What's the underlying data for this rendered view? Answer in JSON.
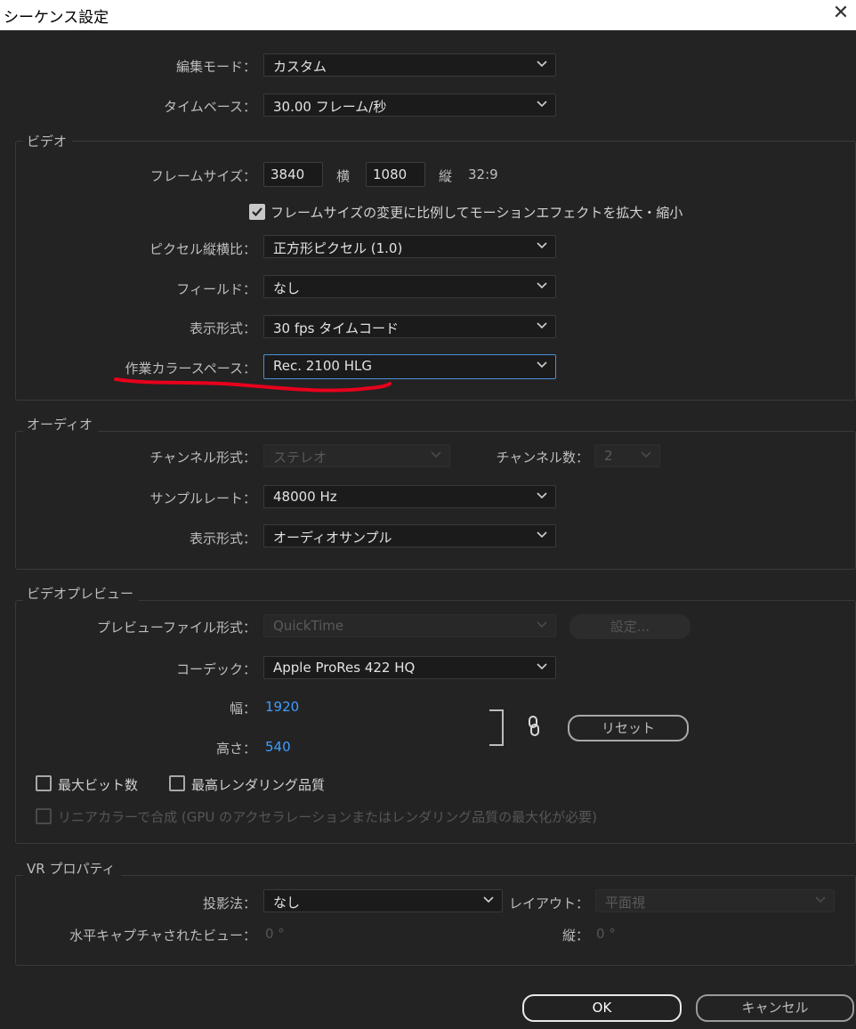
{
  "window": {
    "title": "シーケンス設定",
    "close_icon": "close-icon"
  },
  "general": {
    "edit_mode": {
      "label": "編集モード：",
      "value": "カスタム"
    },
    "timebase": {
      "label": "タイムベース：",
      "value": "30.00  フレーム/秒"
    }
  },
  "video": {
    "title": "ビデオ",
    "frame_size": {
      "label": "フレームサイズ：",
      "width": "3840",
      "h_label": "横",
      "height": "1080",
      "v_label": "縦",
      "ratio": "32:9"
    },
    "scale_checkbox": {
      "label": "フレームサイズの変更に比例してモーションエフェクトを拡大・縮小",
      "checked": true
    },
    "pixel_aspect": {
      "label": "ピクセル縦横比：",
      "value": "正方形ピクセル (1.0)"
    },
    "fields": {
      "label": "フィールド：",
      "value": "なし"
    },
    "display_format": {
      "label": "表示形式：",
      "value": "30 fps タイムコード"
    },
    "working_color": {
      "label": "作業カラースペース：",
      "value": "Rec. 2100 HLG"
    }
  },
  "audio": {
    "title": "オーディオ",
    "channel_format": {
      "label": "チャンネル形式：",
      "value": "ステレオ"
    },
    "channel_count": {
      "label": "チャンネル数：",
      "value": "2"
    },
    "sample_rate": {
      "label": "サンプルレート：",
      "value": "48000 Hz"
    },
    "display_format": {
      "label": "表示形式：",
      "value": "オーディオサンプル"
    }
  },
  "preview": {
    "title": "ビデオプレビュー",
    "file_format": {
      "label": "プレビューファイル形式：",
      "value": "QuickTime",
      "settings_label": "設定..."
    },
    "codec": {
      "label": "コーデック：",
      "value": "Apple ProRes 422 HQ"
    },
    "width": {
      "label": "幅：",
      "value": "1920"
    },
    "height": {
      "label": "高さ：",
      "value": "540"
    },
    "link_icon": "link-icon",
    "reset_label": "リセット",
    "max_bit_depth": {
      "label": "最大ビット数",
      "checked": false
    },
    "max_render_quality": {
      "label": "最高レンダリング品質",
      "checked": false
    },
    "linear_color": {
      "label": "リニアカラーで合成 (GPU のアクセラレーションまたはレンダリング品質の最大化が必要)",
      "checked": false
    }
  },
  "vr": {
    "title": "VR プロパティ",
    "projection": {
      "label": "投影法：",
      "value": "なし"
    },
    "layout": {
      "label": "レイアウト：",
      "value": "平面視"
    },
    "h_captured": {
      "label": "水平キャプチャされたビュー：",
      "value": "0 °"
    },
    "vertical": {
      "label": "縦：",
      "value": "0 °"
    }
  },
  "buttons": {
    "ok": "OK",
    "cancel": "キャンセル"
  },
  "colors": {
    "background": "#232323",
    "annotation": "#e8001c",
    "accent_blue": "#3f9dff"
  }
}
